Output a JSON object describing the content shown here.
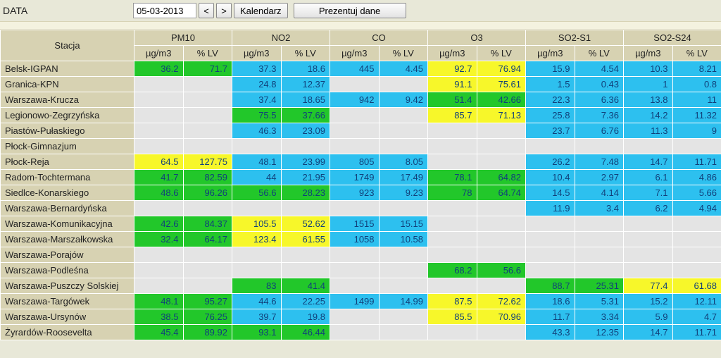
{
  "toolbar": {
    "label": "DATA",
    "date": "05-03-2013",
    "prev": "<",
    "next": ">",
    "calendar": "Kalendarz",
    "present": "Prezentuj dane"
  },
  "headers": {
    "station": "Stacja",
    "groups": [
      "PM10",
      "NO2",
      "CO",
      "O3",
      "SO2-S1",
      "SO2-S24"
    ],
    "sub1": "µg/m3",
    "sub2": "% LV"
  },
  "rows": [
    {
      "name": "Belsk-IGPAN",
      "cells": [
        {
          "v": "36.2",
          "c": "c-green"
        },
        {
          "v": "71.7",
          "c": "c-green"
        },
        {
          "v": "37.3",
          "c": "c-cyan"
        },
        {
          "v": "18.6",
          "c": "c-cyan"
        },
        {
          "v": "445",
          "c": "c-cyan"
        },
        {
          "v": "4.45",
          "c": "c-cyan"
        },
        {
          "v": "92.7",
          "c": "c-yellow"
        },
        {
          "v": "76.94",
          "c": "c-yellow"
        },
        {
          "v": "15.9",
          "c": "c-cyan"
        },
        {
          "v": "4.54",
          "c": "c-cyan"
        },
        {
          "v": "10.3",
          "c": "c-cyan"
        },
        {
          "v": "8.21",
          "c": "c-cyan"
        }
      ]
    },
    {
      "name": "Granica-KPN",
      "cells": [
        {
          "v": "",
          "c": "c-empty"
        },
        {
          "v": "",
          "c": "c-empty"
        },
        {
          "v": "24.8",
          "c": "c-cyan"
        },
        {
          "v": "12.37",
          "c": "c-cyan"
        },
        {
          "v": "",
          "c": "c-empty"
        },
        {
          "v": "",
          "c": "c-empty"
        },
        {
          "v": "91.1",
          "c": "c-yellow"
        },
        {
          "v": "75.61",
          "c": "c-yellow"
        },
        {
          "v": "1.5",
          "c": "c-cyan"
        },
        {
          "v": "0.43",
          "c": "c-cyan"
        },
        {
          "v": "1",
          "c": "c-cyan"
        },
        {
          "v": "0.8",
          "c": "c-cyan"
        }
      ]
    },
    {
      "name": "Warszawa-Krucza",
      "cells": [
        {
          "v": "",
          "c": "c-empty"
        },
        {
          "v": "",
          "c": "c-empty"
        },
        {
          "v": "37.4",
          "c": "c-cyan"
        },
        {
          "v": "18.65",
          "c": "c-cyan"
        },
        {
          "v": "942",
          "c": "c-cyan"
        },
        {
          "v": "9.42",
          "c": "c-cyan"
        },
        {
          "v": "51.4",
          "c": "c-green"
        },
        {
          "v": "42.66",
          "c": "c-green"
        },
        {
          "v": "22.3",
          "c": "c-cyan"
        },
        {
          "v": "6.36",
          "c": "c-cyan"
        },
        {
          "v": "13.8",
          "c": "c-cyan"
        },
        {
          "v": "11",
          "c": "c-cyan"
        }
      ]
    },
    {
      "name": "Legionowo-Zegrzyńska",
      "cells": [
        {
          "v": "",
          "c": "c-empty"
        },
        {
          "v": "",
          "c": "c-empty"
        },
        {
          "v": "75.5",
          "c": "c-green"
        },
        {
          "v": "37.66",
          "c": "c-green"
        },
        {
          "v": "",
          "c": "c-empty"
        },
        {
          "v": "",
          "c": "c-empty"
        },
        {
          "v": "85.7",
          "c": "c-yellow"
        },
        {
          "v": "71.13",
          "c": "c-yellow"
        },
        {
          "v": "25.8",
          "c": "c-cyan"
        },
        {
          "v": "7.36",
          "c": "c-cyan"
        },
        {
          "v": "14.2",
          "c": "c-cyan"
        },
        {
          "v": "11.32",
          "c": "c-cyan"
        }
      ]
    },
    {
      "name": "Piastów-Pułaskiego",
      "cells": [
        {
          "v": "",
          "c": "c-empty"
        },
        {
          "v": "",
          "c": "c-empty"
        },
        {
          "v": "46.3",
          "c": "c-cyan"
        },
        {
          "v": "23.09",
          "c": "c-cyan"
        },
        {
          "v": "",
          "c": "c-empty"
        },
        {
          "v": "",
          "c": "c-empty"
        },
        {
          "v": "",
          "c": "c-empty"
        },
        {
          "v": "",
          "c": "c-empty"
        },
        {
          "v": "23.7",
          "c": "c-cyan"
        },
        {
          "v": "6.76",
          "c": "c-cyan"
        },
        {
          "v": "11.3",
          "c": "c-cyan"
        },
        {
          "v": "9",
          "c": "c-cyan"
        }
      ]
    },
    {
      "name": "Płock-Gimnazjum",
      "cells": [
        {
          "v": "",
          "c": "c-empty"
        },
        {
          "v": "",
          "c": "c-empty"
        },
        {
          "v": "",
          "c": "c-empty"
        },
        {
          "v": "",
          "c": "c-empty"
        },
        {
          "v": "",
          "c": "c-empty"
        },
        {
          "v": "",
          "c": "c-empty"
        },
        {
          "v": "",
          "c": "c-empty"
        },
        {
          "v": "",
          "c": "c-empty"
        },
        {
          "v": "",
          "c": "c-empty"
        },
        {
          "v": "",
          "c": "c-empty"
        },
        {
          "v": "",
          "c": "c-empty"
        },
        {
          "v": "",
          "c": "c-empty"
        }
      ]
    },
    {
      "name": "Płock-Reja",
      "cells": [
        {
          "v": "64.5",
          "c": "c-yellow"
        },
        {
          "v": "127.75",
          "c": "c-yellow"
        },
        {
          "v": "48.1",
          "c": "c-cyan"
        },
        {
          "v": "23.99",
          "c": "c-cyan"
        },
        {
          "v": "805",
          "c": "c-cyan"
        },
        {
          "v": "8.05",
          "c": "c-cyan"
        },
        {
          "v": "",
          "c": "c-empty"
        },
        {
          "v": "",
          "c": "c-empty"
        },
        {
          "v": "26.2",
          "c": "c-cyan"
        },
        {
          "v": "7.48",
          "c": "c-cyan"
        },
        {
          "v": "14.7",
          "c": "c-cyan"
        },
        {
          "v": "11.71",
          "c": "c-cyan"
        }
      ]
    },
    {
      "name": "Radom-Tochtermana",
      "cells": [
        {
          "v": "41.7",
          "c": "c-green"
        },
        {
          "v": "82.59",
          "c": "c-green"
        },
        {
          "v": "44",
          "c": "c-cyan"
        },
        {
          "v": "21.95",
          "c": "c-cyan"
        },
        {
          "v": "1749",
          "c": "c-cyan"
        },
        {
          "v": "17.49",
          "c": "c-cyan"
        },
        {
          "v": "78.1",
          "c": "c-green"
        },
        {
          "v": "64.82",
          "c": "c-green"
        },
        {
          "v": "10.4",
          "c": "c-cyan"
        },
        {
          "v": "2.97",
          "c": "c-cyan"
        },
        {
          "v": "6.1",
          "c": "c-cyan"
        },
        {
          "v": "4.86",
          "c": "c-cyan"
        }
      ]
    },
    {
      "name": "Siedlce-Konarskiego",
      "cells": [
        {
          "v": "48.6",
          "c": "c-green"
        },
        {
          "v": "96.26",
          "c": "c-green"
        },
        {
          "v": "56.6",
          "c": "c-green"
        },
        {
          "v": "28.23",
          "c": "c-green"
        },
        {
          "v": "923",
          "c": "c-cyan"
        },
        {
          "v": "9.23",
          "c": "c-cyan"
        },
        {
          "v": "78",
          "c": "c-green"
        },
        {
          "v": "64.74",
          "c": "c-green"
        },
        {
          "v": "14.5",
          "c": "c-cyan"
        },
        {
          "v": "4.14",
          "c": "c-cyan"
        },
        {
          "v": "7.1",
          "c": "c-cyan"
        },
        {
          "v": "5.66",
          "c": "c-cyan"
        }
      ]
    },
    {
      "name": "Warszawa-Bernardyńska",
      "cells": [
        {
          "v": "",
          "c": "c-empty"
        },
        {
          "v": "",
          "c": "c-empty"
        },
        {
          "v": "",
          "c": "c-empty"
        },
        {
          "v": "",
          "c": "c-empty"
        },
        {
          "v": "",
          "c": "c-empty"
        },
        {
          "v": "",
          "c": "c-empty"
        },
        {
          "v": "",
          "c": "c-empty"
        },
        {
          "v": "",
          "c": "c-empty"
        },
        {
          "v": "11.9",
          "c": "c-cyan"
        },
        {
          "v": "3.4",
          "c": "c-cyan"
        },
        {
          "v": "6.2",
          "c": "c-cyan"
        },
        {
          "v": "4.94",
          "c": "c-cyan"
        }
      ]
    },
    {
      "name": "Warszawa-Komunikacyjna",
      "cells": [
        {
          "v": "42.6",
          "c": "c-green"
        },
        {
          "v": "84.37",
          "c": "c-green"
        },
        {
          "v": "105.5",
          "c": "c-yellow"
        },
        {
          "v": "52.62",
          "c": "c-yellow"
        },
        {
          "v": "1515",
          "c": "c-cyan"
        },
        {
          "v": "15.15",
          "c": "c-cyan"
        },
        {
          "v": "",
          "c": "c-empty"
        },
        {
          "v": "",
          "c": "c-empty"
        },
        {
          "v": "",
          "c": "c-empty"
        },
        {
          "v": "",
          "c": "c-empty"
        },
        {
          "v": "",
          "c": "c-empty"
        },
        {
          "v": "",
          "c": "c-empty"
        }
      ]
    },
    {
      "name": "Warszawa-Marszałkowska",
      "cells": [
        {
          "v": "32.4",
          "c": "c-green"
        },
        {
          "v": "64.17",
          "c": "c-green"
        },
        {
          "v": "123.4",
          "c": "c-yellow"
        },
        {
          "v": "61.55",
          "c": "c-yellow"
        },
        {
          "v": "1058",
          "c": "c-cyan"
        },
        {
          "v": "10.58",
          "c": "c-cyan"
        },
        {
          "v": "",
          "c": "c-empty"
        },
        {
          "v": "",
          "c": "c-empty"
        },
        {
          "v": "",
          "c": "c-empty"
        },
        {
          "v": "",
          "c": "c-empty"
        },
        {
          "v": "",
          "c": "c-empty"
        },
        {
          "v": "",
          "c": "c-empty"
        }
      ]
    },
    {
      "name": "Warszawa-Porajów",
      "cells": [
        {
          "v": "",
          "c": "c-empty"
        },
        {
          "v": "",
          "c": "c-empty"
        },
        {
          "v": "",
          "c": "c-empty"
        },
        {
          "v": "",
          "c": "c-empty"
        },
        {
          "v": "",
          "c": "c-empty"
        },
        {
          "v": "",
          "c": "c-empty"
        },
        {
          "v": "",
          "c": "c-empty"
        },
        {
          "v": "",
          "c": "c-empty"
        },
        {
          "v": "",
          "c": "c-empty"
        },
        {
          "v": "",
          "c": "c-empty"
        },
        {
          "v": "",
          "c": "c-empty"
        },
        {
          "v": "",
          "c": "c-empty"
        }
      ]
    },
    {
      "name": "Warszawa-Podleśna",
      "cells": [
        {
          "v": "",
          "c": "c-empty"
        },
        {
          "v": "",
          "c": "c-empty"
        },
        {
          "v": "",
          "c": "c-empty"
        },
        {
          "v": "",
          "c": "c-empty"
        },
        {
          "v": "",
          "c": "c-empty"
        },
        {
          "v": "",
          "c": "c-empty"
        },
        {
          "v": "68.2",
          "c": "c-green"
        },
        {
          "v": "56.6",
          "c": "c-green"
        },
        {
          "v": "",
          "c": "c-empty"
        },
        {
          "v": "",
          "c": "c-empty"
        },
        {
          "v": "",
          "c": "c-empty"
        },
        {
          "v": "",
          "c": "c-empty"
        }
      ]
    },
    {
      "name": "Warszawa-Puszczy Solskiej",
      "cells": [
        {
          "v": "",
          "c": "c-empty"
        },
        {
          "v": "",
          "c": "c-empty"
        },
        {
          "v": "83",
          "c": "c-green"
        },
        {
          "v": "41.4",
          "c": "c-green"
        },
        {
          "v": "",
          "c": "c-empty"
        },
        {
          "v": "",
          "c": "c-empty"
        },
        {
          "v": "",
          "c": "c-empty"
        },
        {
          "v": "",
          "c": "c-empty"
        },
        {
          "v": "88.7",
          "c": "c-green"
        },
        {
          "v": "25.31",
          "c": "c-green"
        },
        {
          "v": "77.4",
          "c": "c-yellow"
        },
        {
          "v": "61.68",
          "c": "c-yellow"
        }
      ]
    },
    {
      "name": "Warszawa-Targówek",
      "cells": [
        {
          "v": "48.1",
          "c": "c-green"
        },
        {
          "v": "95.27",
          "c": "c-green"
        },
        {
          "v": "44.6",
          "c": "c-cyan"
        },
        {
          "v": "22.25",
          "c": "c-cyan"
        },
        {
          "v": "1499",
          "c": "c-cyan"
        },
        {
          "v": "14.99",
          "c": "c-cyan"
        },
        {
          "v": "87.5",
          "c": "c-yellow"
        },
        {
          "v": "72.62",
          "c": "c-yellow"
        },
        {
          "v": "18.6",
          "c": "c-cyan"
        },
        {
          "v": "5.31",
          "c": "c-cyan"
        },
        {
          "v": "15.2",
          "c": "c-cyan"
        },
        {
          "v": "12.11",
          "c": "c-cyan"
        }
      ]
    },
    {
      "name": "Warszawa-Ursynów",
      "cells": [
        {
          "v": "38.5",
          "c": "c-green"
        },
        {
          "v": "76.25",
          "c": "c-green"
        },
        {
          "v": "39.7",
          "c": "c-cyan"
        },
        {
          "v": "19.8",
          "c": "c-cyan"
        },
        {
          "v": "",
          "c": "c-empty"
        },
        {
          "v": "",
          "c": "c-empty"
        },
        {
          "v": "85.5",
          "c": "c-yellow"
        },
        {
          "v": "70.96",
          "c": "c-yellow"
        },
        {
          "v": "11.7",
          "c": "c-cyan"
        },
        {
          "v": "3.34",
          "c": "c-cyan"
        },
        {
          "v": "5.9",
          "c": "c-cyan"
        },
        {
          "v": "4.7",
          "c": "c-cyan"
        }
      ]
    },
    {
      "name": "Żyrardów-Roosevelta",
      "cells": [
        {
          "v": "45.4",
          "c": "c-green"
        },
        {
          "v": "89.92",
          "c": "c-green"
        },
        {
          "v": "93.1",
          "c": "c-green"
        },
        {
          "v": "46.44",
          "c": "c-green"
        },
        {
          "v": "",
          "c": "c-empty"
        },
        {
          "v": "",
          "c": "c-empty"
        },
        {
          "v": "",
          "c": "c-empty"
        },
        {
          "v": "",
          "c": "c-empty"
        },
        {
          "v": "43.3",
          "c": "c-cyan"
        },
        {
          "v": "12.35",
          "c": "c-cyan"
        },
        {
          "v": "14.7",
          "c": "c-cyan"
        },
        {
          "v": "11.71",
          "c": "c-cyan"
        }
      ]
    }
  ]
}
